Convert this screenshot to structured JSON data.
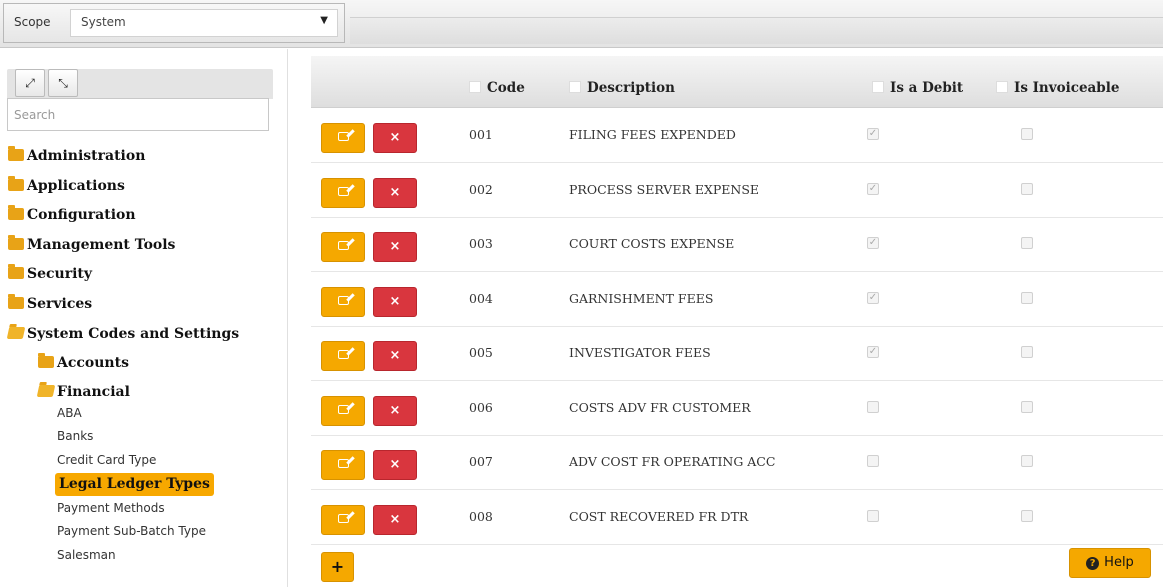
{
  "scope": {
    "label": "Scope",
    "value": "System"
  },
  "sidebar": {
    "expand_icon": "expand-icon",
    "collapse_icon": "collapse-icon",
    "search_placeholder": "Search",
    "tree": [
      "Administration",
      "Applications",
      "Configuration",
      "Management Tools",
      "Security",
      "Services",
      "System Codes and Settings"
    ],
    "sub": [
      "Accounts",
      "Financial"
    ],
    "leaves": [
      "ABA",
      "Banks",
      "Credit Card Type",
      "Legal Ledger Types",
      "Payment Methods",
      "Payment Sub-Batch Type",
      "Salesman"
    ],
    "selected": "Legal Ledger Types"
  },
  "grid": {
    "columns": [
      "Code",
      "Description",
      "Is a Debit",
      "Is Invoiceable"
    ],
    "rows": [
      {
        "code": "001",
        "description": "FILING FEES EXPENDED",
        "is_debit": true,
        "is_invoiceable": false
      },
      {
        "code": "002",
        "description": "PROCESS SERVER EXPENSE",
        "is_debit": true,
        "is_invoiceable": false
      },
      {
        "code": "003",
        "description": "COURT COSTS EXPENSE",
        "is_debit": true,
        "is_invoiceable": false
      },
      {
        "code": "004",
        "description": "GARNISHMENT FEES",
        "is_debit": true,
        "is_invoiceable": false
      },
      {
        "code": "005",
        "description": "INVESTIGATOR FEES",
        "is_debit": true,
        "is_invoiceable": false
      },
      {
        "code": "006",
        "description": "COSTS ADV FR CUSTOMER",
        "is_debit": false,
        "is_invoiceable": false
      },
      {
        "code": "007",
        "description": "ADV COST FR OPERATING ACC",
        "is_debit": false,
        "is_invoiceable": false
      },
      {
        "code": "008",
        "description": "COST RECOVERED FR DTR",
        "is_debit": false,
        "is_invoiceable": false
      }
    ]
  },
  "buttons": {
    "add": "+",
    "help": "Help",
    "delete": "×"
  },
  "colors": {
    "accent": "#f5a800",
    "danger": "#d9363e",
    "selected": "#f7a800"
  }
}
